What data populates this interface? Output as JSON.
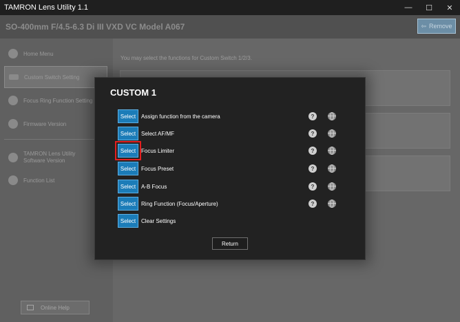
{
  "window": {
    "title": "TAMRON Lens Utility 1.1",
    "controls": [
      "—",
      "☐",
      "✕"
    ]
  },
  "header": {
    "model": "SO-400mm F/4.5-6.3 Di III VXD VC    Model A067",
    "remove_label": "Remove"
  },
  "sidebar": {
    "items": [
      {
        "label": "Home Menu"
      },
      {
        "label": "Custom Switch Setting"
      },
      {
        "label": "Focus Ring Function Setting"
      },
      {
        "label": "Firmware Version"
      },
      {
        "label": "TAMRON Lens Utility Software Version"
      },
      {
        "label": "Function List"
      }
    ],
    "online_help": "Online Help"
  },
  "content": {
    "note": "You may select the functions for Custom Switch 1/2/3."
  },
  "modal": {
    "title": "CUSTOM 1",
    "select_label": "Select",
    "help_glyph": "?",
    "rows": [
      {
        "label": "Assign function from the camera"
      },
      {
        "label": "Select AF/MF"
      },
      {
        "label": "Focus Limiter"
      },
      {
        "label": "Focus Preset"
      },
      {
        "label": "A-B Focus"
      },
      {
        "label": "Ring Function (Focus/Aperture)"
      },
      {
        "label": "Clear Settings"
      }
    ],
    "return_label": "Return"
  },
  "colors": {
    "select_button": "#1b7cb8",
    "highlight": "#e41f1f"
  }
}
